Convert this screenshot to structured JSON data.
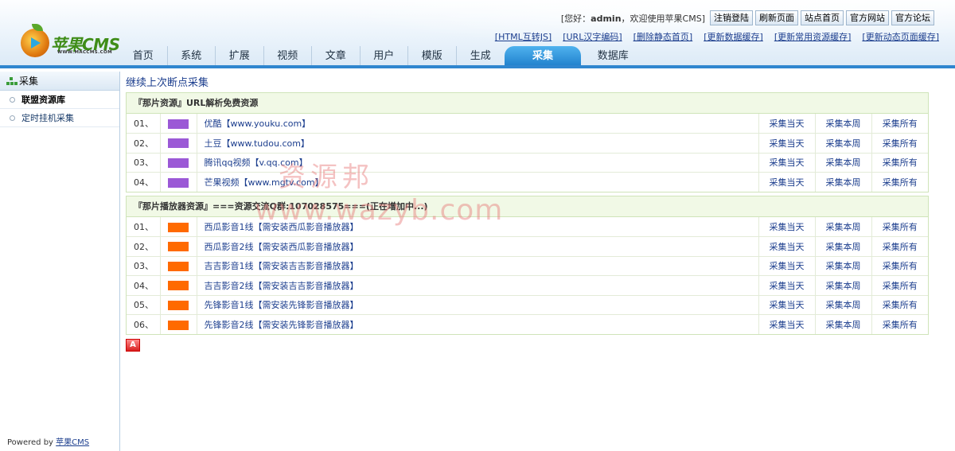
{
  "header": {
    "logo": {
      "name": "苹果CMS",
      "tagline": "WWW.MACCMS.COM"
    },
    "greeting": {
      "prefix": "[您好：",
      "user": "admin",
      "suffix": "，欢迎使用苹果CMS]"
    },
    "buttons": [
      "注销登陆",
      "刷新页面",
      "站点首页",
      "官方网站",
      "官方论坛"
    ],
    "quick_links": [
      "[HTML互转JS]",
      "[URL汉字编码]",
      "[删除静态首页]",
      "[更新数据缓存]",
      "[更新常用资源缓存]",
      "[更新动态页面缓存]"
    ],
    "nav": [
      {
        "label": "首页"
      },
      {
        "label": "系统"
      },
      {
        "label": "扩展"
      },
      {
        "label": "视频"
      },
      {
        "label": "文章"
      },
      {
        "label": "用户"
      },
      {
        "label": "模版"
      },
      {
        "label": "生成"
      },
      {
        "label": "采集",
        "active": true
      },
      {
        "label": "数据库"
      }
    ]
  },
  "sidebar": {
    "title": "采集",
    "items": [
      {
        "label": "联盟资源库",
        "active": true
      },
      {
        "label": "定时挂机采集",
        "active": false
      }
    ],
    "powered_prefix": "Powered by ",
    "powered_link": "苹果CMS"
  },
  "main": {
    "continue_link": "继续上次断点采集",
    "actions": [
      "采集当天",
      "采集本周",
      "采集所有"
    ],
    "sections": [
      {
        "title": "『那片资源』URL解析免费资源",
        "color": "#9b59d6",
        "rows": [
          {
            "num": "01、",
            "name": "优酷【www.youku.com】"
          },
          {
            "num": "02、",
            "name": "土豆【www.tudou.com】"
          },
          {
            "num": "03、",
            "name": "腾讯qq视频【v.qq.com】"
          },
          {
            "num": "04、",
            "name": "芒果视频【www.mgtv.com】"
          }
        ]
      },
      {
        "title": "『那片播放器资源』===资源交流Q群:107028575===(正在增加中...)",
        "color": "#ff6a00",
        "rows": [
          {
            "num": "01、",
            "name": "西瓜影音1线【需安装西瓜影音播放器】"
          },
          {
            "num": "02、",
            "name": "西瓜影音2线【需安装西瓜影音播放器】"
          },
          {
            "num": "03、",
            "name": "吉吉影音1线【需安装吉吉影音播放器】"
          },
          {
            "num": "04、",
            "name": "吉吉影音2线【需安装吉吉影音播放器】"
          },
          {
            "num": "05、",
            "name": "先锋影音1线【需安装先锋影音播放器】"
          },
          {
            "num": "06、",
            "name": "先锋影音2线【需安装先锋影音播放器】"
          }
        ]
      }
    ],
    "bottom_icon": "A"
  },
  "watermark": {
    "cn": "资源邦",
    "url": "www.wazyb.com"
  },
  "colors": {
    "accent": "#2f86cf",
    "link": "#1c3e8e",
    "section_bg": "#f1f9e6"
  }
}
